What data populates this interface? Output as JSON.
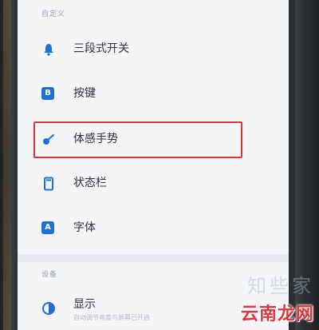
{
  "sections": {
    "customize_header": "自定义",
    "device_header": "设备"
  },
  "items": [
    {
      "label": "三段式开关",
      "icon": "alert-slider-icon"
    },
    {
      "label": "按键",
      "icon": "button-badge-icon",
      "badge": "B"
    },
    {
      "label": "体感手势",
      "icon": "gesture-icon"
    },
    {
      "label": "状态栏",
      "icon": "status-bar-icon"
    },
    {
      "label": "字体",
      "icon": "font-badge-icon",
      "badge": "A"
    }
  ],
  "device_items": [
    {
      "label": "显示",
      "sub": "自动调节亮度与屏幕已开启",
      "icon": "display-icon"
    }
  ],
  "watermark": {
    "text": "云南龙网",
    "faint": "知些家"
  },
  "colors": {
    "accent": "#1f6fd9",
    "highlight": "#d9353b"
  }
}
